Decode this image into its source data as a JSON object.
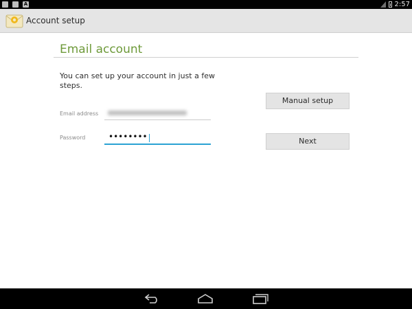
{
  "status_bar": {
    "time": "2:57"
  },
  "action_bar": {
    "title": "Account setup",
    "icon": "email-app-icon"
  },
  "form": {
    "section_title": "Email account",
    "intro": "You can set up your account in just a few steps.",
    "email_label": "Email address",
    "email_value_obscured": true,
    "password_label": "Password",
    "password_value": "••••••••"
  },
  "buttons": {
    "manual_setup": "Manual setup",
    "next": "Next"
  },
  "nav": {
    "back": "back-icon",
    "home": "home-icon",
    "recent": "recent-apps-icon"
  },
  "colors": {
    "accent": "#6e9a3a",
    "focus": "#2aa1d3",
    "actionbar": "#e5e5e5"
  }
}
